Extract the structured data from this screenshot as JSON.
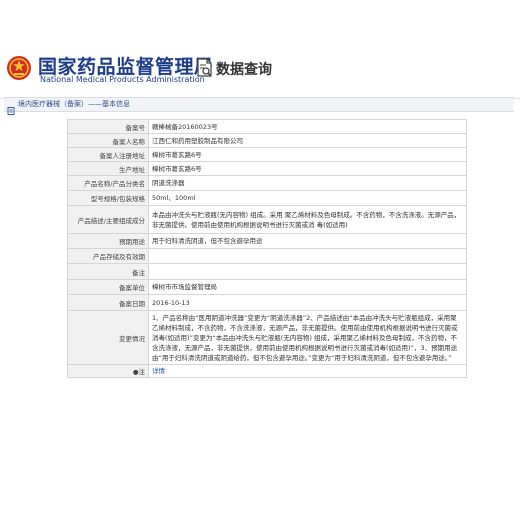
{
  "header": {
    "org_cn": "国家药品监督管理局",
    "org_en": "National Medical Products Administration",
    "query_title": "数据查询",
    "emblem_icon": "national-emblem-icon",
    "query_icon": "document-search-icon"
  },
  "breadcrumb": {
    "text": "境内医疗器械（备案）——基本信息",
    "icon": "document-icon"
  },
  "record": {
    "rows": [
      {
        "label": "备案号",
        "value": "赣棒械备20160023号"
      },
      {
        "label": "备案人名称",
        "value": "江西仁和药用塑胶制品有限公司"
      },
      {
        "label": "备案人注册地址",
        "value": "樟树市葛玄路6号"
      },
      {
        "label": "生产地址",
        "value": "樟树市葛玄路6号"
      },
      {
        "label": "产品名称/产品分类名",
        "value": "阴道洗涤器"
      },
      {
        "label": "型号规格/包装规格",
        "value": "50ml、100ml"
      },
      {
        "label": "产品描述/主要组成成分",
        "value": "本品由冲洗头与贮液瓶(无内容物) 组成。采用 聚乙烯材料及色母制成。不含药物，不含洗涤液。无源产品，非无菌提供。使用前由使用机构根据说明书进行灭菌或消 毒(如适用)"
      },
      {
        "label": "预期用途",
        "value": "用于妇科清洗阴道，但不包含避孕用途"
      },
      {
        "label": "产品存储及有效期",
        "value": ""
      },
      {
        "label": "备注",
        "value": ""
      },
      {
        "label": "备案单位",
        "value": "樟树市市场监督管理局"
      },
      {
        "label": "备案日期",
        "value": "2016-10-13"
      },
      {
        "label": "变更情况",
        "value": "1、产品名称由“医用阴道冲洗器”变更为“阴道洗涤器”2、产品描述由“本品由冲洗头与贮液瓶组成，采用聚乙烯材料制成，不含药物，不含洗涤液，无源产品，非无菌提供。使用前由使用机构根据说明书进行灭菌或消毒(如适用)”变更为“本品由冲洗头与贮液瓶(无内容物) 组成，采用聚乙烯材料及色母制成，不含药物，不含洗涤液，无源产品，非无菌提供，使用前由使用机构根据说明书进行灭菌或消毒(如适用)”，3、预期用途由“用于妇科清洗阴道或阴道给药，但不包含避孕用途。”变更为“用于妇科清洗阴道，但不包含避孕用途。”"
      }
    ],
    "detail_row": {
      "label": "●注",
      "link_text": "详情"
    }
  }
}
